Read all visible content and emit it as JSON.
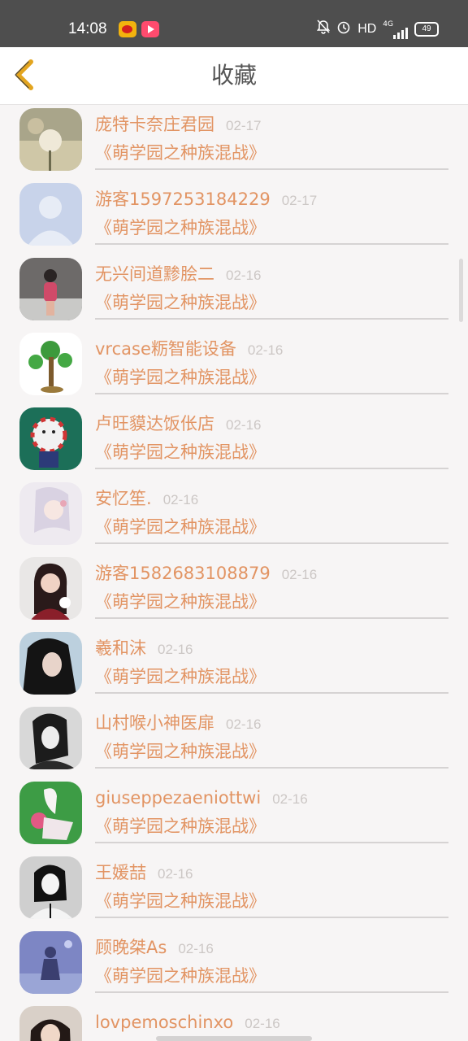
{
  "status_bar": {
    "time": "14:08",
    "hd_label": "HD",
    "network_label": "4G",
    "battery_level": "49",
    "icons": [
      "weibo-app-icon",
      "video-app-icon",
      "bell-muted-icon",
      "alarm-icon",
      "signal-icon",
      "battery-icon"
    ]
  },
  "header": {
    "title": "收藏",
    "back_icon": "chevron-left-icon",
    "accent_color": "#e3a51f"
  },
  "colors": {
    "username": "#e29463",
    "date": "#ccc7c5",
    "background": "#f7f5f5"
  },
  "favorites": [
    {
      "user": "庞特卡奈庄君园",
      "date": "02-17",
      "game": "《萌学园之种族混战》"
    },
    {
      "user": "游客1597253184229",
      "date": "02-17",
      "game": "《萌学园之种族混战》"
    },
    {
      "user": "无兴间道黪脍二",
      "date": "02-16",
      "game": "《萌学园之种族混战》"
    },
    {
      "user": "vrcase粝智能设备",
      "date": "02-16",
      "game": "《萌学园之种族混战》"
    },
    {
      "user": "卢旺貘达饭伥店",
      "date": "02-16",
      "game": "《萌学园之种族混战》"
    },
    {
      "user": "安忆笙.",
      "date": "02-16",
      "game": "《萌学园之种族混战》"
    },
    {
      "user": "游客1582683108879",
      "date": "02-16",
      "game": "《萌学园之种族混战》"
    },
    {
      "user": "羲和沫",
      "date": "02-16",
      "game": "《萌学园之种族混战》"
    },
    {
      "user": "山村喉小神医扉",
      "date": "02-16",
      "game": "《萌学园之种族混战》"
    },
    {
      "user": "giuseppezaeniottwi",
      "date": "02-16",
      "game": "《萌学园之种族混战》"
    },
    {
      "user": "王媛喆",
      "date": "02-16",
      "game": "《萌学园之种族混战》"
    },
    {
      "user": "顾晚桀As",
      "date": "02-16",
      "game": "《萌学园之种族混战》"
    },
    {
      "user": "lovpemoschinxo",
      "date": "02-16",
      "game": ""
    }
  ]
}
